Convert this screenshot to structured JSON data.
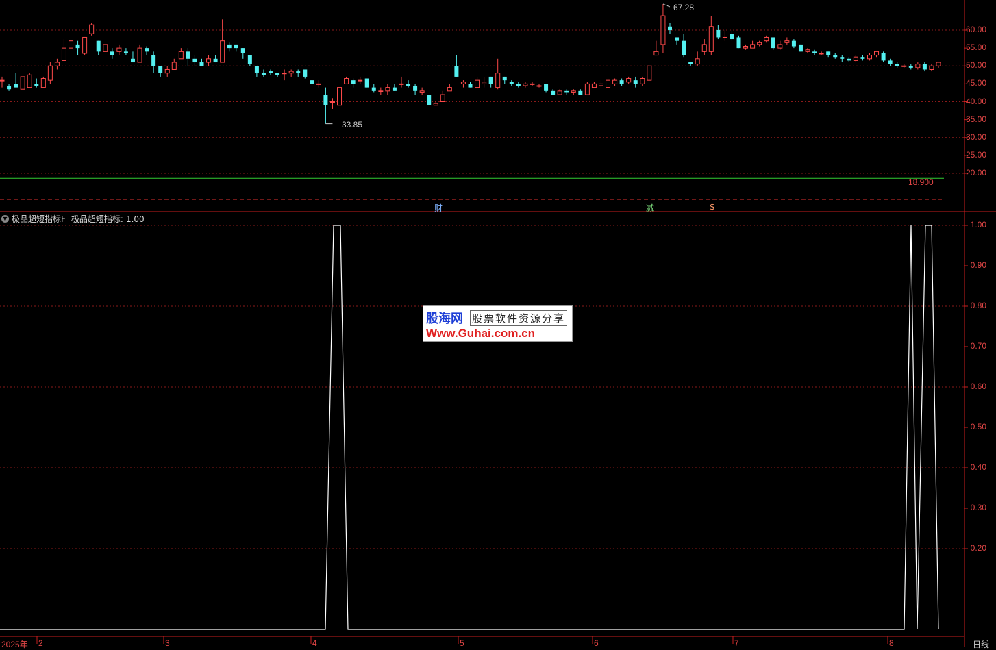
{
  "colors": {
    "up": "#ff4a4a",
    "down": "#54f0f0",
    "axis": "#c81e1e",
    "grid": "#8a1a1a",
    "line": "#ffffff",
    "ref": "#33cc33"
  },
  "price_axis": {
    "ticks": [
      "60.00",
      "55.00",
      "50.00",
      "45.00",
      "40.00",
      "35.00",
      "30.00",
      "25.00",
      "20.00"
    ]
  },
  "indicator_axis": {
    "ticks": [
      "1.00",
      "0.90",
      "0.80",
      "0.70",
      "0.60",
      "0.50",
      "0.40",
      "0.30",
      "0.20"
    ]
  },
  "time_axis": {
    "labels": [
      "2025年",
      "2",
      "3",
      "4",
      "5",
      "6",
      "7",
      "8"
    ]
  },
  "period_label": "日线",
  "annotations": {
    "high": "67.28",
    "low": "33.85",
    "ref_level": "18.900"
  },
  "marks": {
    "cai": "财",
    "jian": "减",
    "dollar": "$"
  },
  "indicator": {
    "name": "极品超短指标F",
    "series_label": "极品超短指标:",
    "value": "1.00",
    "toggle_icon": "chevron-down-icon"
  },
  "watermark": {
    "site_name": "股海网",
    "slogan": "股票软件资源分享",
    "url": "Www.Guhai.com.cn"
  },
  "chart_data": {
    "type": "candlestick",
    "price_ylim": [
      15,
      68
    ],
    "candles": [
      [
        46.0,
        46.0,
        47.0,
        44.0
      ],
      [
        44.5,
        43.5,
        45.0,
        43.0
      ],
      [
        45.0,
        44.0,
        48.0,
        44.0
      ],
      [
        43.5,
        47.0,
        47.0,
        43.5
      ],
      [
        44.0,
        47.5,
        48.0,
        44.0
      ],
      [
        45.0,
        44.5,
        46.5,
        44.0
      ],
      [
        44.0,
        46.5,
        47.0,
        44.0
      ],
      [
        46.0,
        50.0,
        51.0,
        45.0
      ],
      [
        50.0,
        51.0,
        52.0,
        49.0
      ],
      [
        51.5,
        55.0,
        57.5,
        51.5
      ],
      [
        55.0,
        57.0,
        59.0,
        54.0
      ],
      [
        56.0,
        55.0,
        57.0,
        53.0
      ],
      [
        53.5,
        58.0,
        58.0,
        53.0
      ],
      [
        59.0,
        61.5,
        62.0,
        58.5
      ],
      [
        57.0,
        54.0,
        57.0,
        53.0
      ],
      [
        54.0,
        56.0,
        56.0,
        54.0
      ],
      [
        54.0,
        53.0,
        55.0,
        52.0
      ],
      [
        54.0,
        55.0,
        56.0,
        53.0
      ],
      [
        54.0,
        53.5,
        55.0,
        53.0
      ],
      [
        52.0,
        51.0,
        54.0,
        51.0
      ],
      [
        51.0,
        55.0,
        56.0,
        51.0
      ],
      [
        55.0,
        54.0,
        55.5,
        53.0
      ],
      [
        53.0,
        50.0,
        54.0,
        48.0
      ],
      [
        50.0,
        48.0,
        50.0,
        47.0
      ],
      [
        48.0,
        49.0,
        50.0,
        47.0
      ],
      [
        49.0,
        51.0,
        52.0,
        49.0
      ],
      [
        52.0,
        54.0,
        55.0,
        52.0
      ],
      [
        54.0,
        52.0,
        55.0,
        50.0
      ],
      [
        52.0,
        51.0,
        53.0,
        50.0
      ],
      [
        51.0,
        50.0,
        52.0,
        50.0
      ],
      [
        51.0,
        52.0,
        53.0,
        50.0
      ],
      [
        52.0,
        51.0,
        53.0,
        51.0
      ],
      [
        51.0,
        57.0,
        63.0,
        51.0
      ],
      [
        56.0,
        55.0,
        56.5,
        54.0
      ],
      [
        56.0,
        55.0,
        56.0,
        54.0
      ],
      [
        55.0,
        53.5,
        55.0,
        52.0
      ],
      [
        53.0,
        50.5,
        53.0,
        50.0
      ],
      [
        50.0,
        48.0,
        50.0,
        47.0
      ],
      [
        48.0,
        47.5,
        49.0,
        47.0
      ],
      [
        48.5,
        48.0,
        49.0,
        47.5
      ],
      [
        48.0,
        47.5,
        48.0,
        47.0
      ],
      [
        48.0,
        48.0,
        49.0,
        46.0
      ],
      [
        48.0,
        48.5,
        49.0,
        47.0
      ],
      [
        48.5,
        48.0,
        49.0,
        47.0
      ],
      [
        49.0,
        47.0,
        49.0,
        46.5
      ],
      [
        46.0,
        45.0,
        46.0,
        45.0
      ],
      [
        45.0,
        45.0,
        46.0,
        44.0
      ],
      [
        42.0,
        39.0,
        44.0,
        33.85
      ],
      [
        40.0,
        40.0,
        41.0,
        38.0
      ],
      [
        39.0,
        44.0,
        44.0,
        39.0
      ],
      [
        45.0,
        46.5,
        47.0,
        45.0
      ],
      [
        46.0,
        45.0,
        46.5,
        44.0
      ],
      [
        46.0,
        46.0,
        47.0,
        45.0
      ],
      [
        46.5,
        44.0,
        46.5,
        44.0
      ],
      [
        44.0,
        43.0,
        45.0,
        42.5
      ],
      [
        43.0,
        43.0,
        44.0,
        42.0
      ],
      [
        43.0,
        44.0,
        45.0,
        42.0
      ],
      [
        44.0,
        43.0,
        45.0,
        43.0
      ],
      [
        45.0,
        45.0,
        47.0,
        44.0
      ],
      [
        45.0,
        44.5,
        46.0,
        44.0
      ],
      [
        44.5,
        43.0,
        45.0,
        42.0
      ],
      [
        42.5,
        43.0,
        44.0,
        42.0
      ],
      [
        42.0,
        39.0,
        42.0,
        39.0
      ],
      [
        39.0,
        39.5,
        40.0,
        39.0
      ],
      [
        40.0,
        42.0,
        43.0,
        40.0
      ],
      [
        43.0,
        44.0,
        45.0,
        43.0
      ],
      [
        50.0,
        47.0,
        53.0,
        47.0
      ],
      [
        45.0,
        45.5,
        46.0,
        44.0
      ],
      [
        45.0,
        44.0,
        45.5,
        44.0
      ],
      [
        44.0,
        46.0,
        47.0,
        44.0
      ],
      [
        45.0,
        45.5,
        47.0,
        44.0
      ],
      [
        47.0,
        45.0,
        47.0,
        44.0
      ],
      [
        44.0,
        48.0,
        52.0,
        43.5
      ],
      [
        47.0,
        46.0,
        47.0,
        45.0
      ],
      [
        45.5,
        45.0,
        46.0,
        44.5
      ],
      [
        45.0,
        44.5,
        45.5,
        44.0
      ],
      [
        44.5,
        45.0,
        45.5,
        44.0
      ],
      [
        45.0,
        45.0,
        45.5,
        44.5
      ],
      [
        44.5,
        44.5,
        45.0,
        44.0
      ],
      [
        45.0,
        43.0,
        45.0,
        42.5
      ],
      [
        43.0,
        42.0,
        43.5,
        42.0
      ],
      [
        42.0,
        43.0,
        43.5,
        42.0
      ],
      [
        43.0,
        42.5,
        43.5,
        42.0
      ],
      [
        42.5,
        43.0,
        43.5,
        42.0
      ],
      [
        43.0,
        42.0,
        43.5,
        42.0
      ],
      [
        42.0,
        45.0,
        45.5,
        42.0
      ],
      [
        44.0,
        45.0,
        45.5,
        44.0
      ],
      [
        44.5,
        45.0,
        46.0,
        44.0
      ],
      [
        44.0,
        46.0,
        46.5,
        44.0
      ],
      [
        45.0,
        46.0,
        46.5,
        44.5
      ],
      [
        46.0,
        45.0,
        46.5,
        44.5
      ],
      [
        45.5,
        46.5,
        47.0,
        45.0
      ],
      [
        46.0,
        45.0,
        47.0,
        44.0
      ],
      [
        45.0,
        46.5,
        47.0,
        44.5
      ],
      [
        46.0,
        50.0,
        50.0,
        46.0
      ],
      [
        53.0,
        54.0,
        57.0,
        53.0
      ],
      [
        56.0,
        64.0,
        67.28,
        53.5
      ],
      [
        61.0,
        60.0,
        62.0,
        59.0
      ],
      [
        58.0,
        57.0,
        58.0,
        56.0
      ],
      [
        57.0,
        53.0,
        59.0,
        52.5
      ],
      [
        51.0,
        50.5,
        51.0,
        50.0
      ],
      [
        50.5,
        52.0,
        54.0,
        50.0
      ],
      [
        54.0,
        56.0,
        57.5,
        53.0
      ],
      [
        54.0,
        61.0,
        64.0,
        53.0
      ],
      [
        60.0,
        58.0,
        61.5,
        57.5
      ],
      [
        58.0,
        58.0,
        60.0,
        57.0
      ],
      [
        59.0,
        57.5,
        60.0,
        57.0
      ],
      [
        58.0,
        55.0,
        58.5,
        55.0
      ],
      [
        55.0,
        55.5,
        56.0,
        54.5
      ],
      [
        55.0,
        56.0,
        57.0,
        55.0
      ],
      [
        56.0,
        56.5,
        57.0,
        55.5
      ],
      [
        57.0,
        58.0,
        58.5,
        56.5
      ],
      [
        58.0,
        55.0,
        58.0,
        54.5
      ],
      [
        55.0,
        56.0,
        57.0,
        54.5
      ],
      [
        56.5,
        57.0,
        58.0,
        56.0
      ],
      [
        57.0,
        55.5,
        57.5,
        55.0
      ],
      [
        56.0,
        54.0,
        56.0,
        54.0
      ],
      [
        54.0,
        54.5,
        55.0,
        53.5
      ],
      [
        54.0,
        53.5,
        54.5,
        53.0
      ],
      [
        53.5,
        53.5,
        54.0,
        53.0
      ],
      [
        54.0,
        53.0,
        54.0,
        52.5
      ],
      [
        53.0,
        52.5,
        53.5,
        52.0
      ],
      [
        52.5,
        52.0,
        53.0,
        51.0
      ],
      [
        52.0,
        51.5,
        52.5,
        51.0
      ],
      [
        51.5,
        52.5,
        53.0,
        51.0
      ],
      [
        52.5,
        52.0,
        53.0,
        51.5
      ],
      [
        52.0,
        53.0,
        53.5,
        51.5
      ],
      [
        53.0,
        54.0,
        54.0,
        52.5
      ],
      [
        53.5,
        51.5,
        54.0,
        51.0
      ],
      [
        51.5,
        50.5,
        52.0,
        50.0
      ],
      [
        50.5,
        50.0,
        51.0,
        49.5
      ],
      [
        50.0,
        50.0,
        50.5,
        49.5
      ],
      [
        50.0,
        49.5,
        50.5,
        49.0
      ],
      [
        49.5,
        50.5,
        51.0,
        49.0
      ],
      [
        50.5,
        49.0,
        51.0,
        48.5
      ],
      [
        49.0,
        50.0,
        50.5,
        48.5
      ],
      [
        50.0,
        51.0,
        51.0,
        49.5
      ]
    ],
    "reference_level": 18.9,
    "indicator_ylim": [
      0.0,
      1.0
    ],
    "indicator_series": {
      "name": "极品超短指标",
      "points": [
        [
          0,
          0
        ],
        [
          475,
          0
        ],
        [
          487,
          1
        ],
        [
          497,
          1
        ],
        [
          508,
          0
        ],
        [
          1320,
          0
        ],
        [
          1330,
          1
        ],
        [
          1339,
          0
        ],
        [
          1351,
          1
        ],
        [
          1360,
          1
        ],
        [
          1370,
          0
        ]
      ]
    }
  }
}
